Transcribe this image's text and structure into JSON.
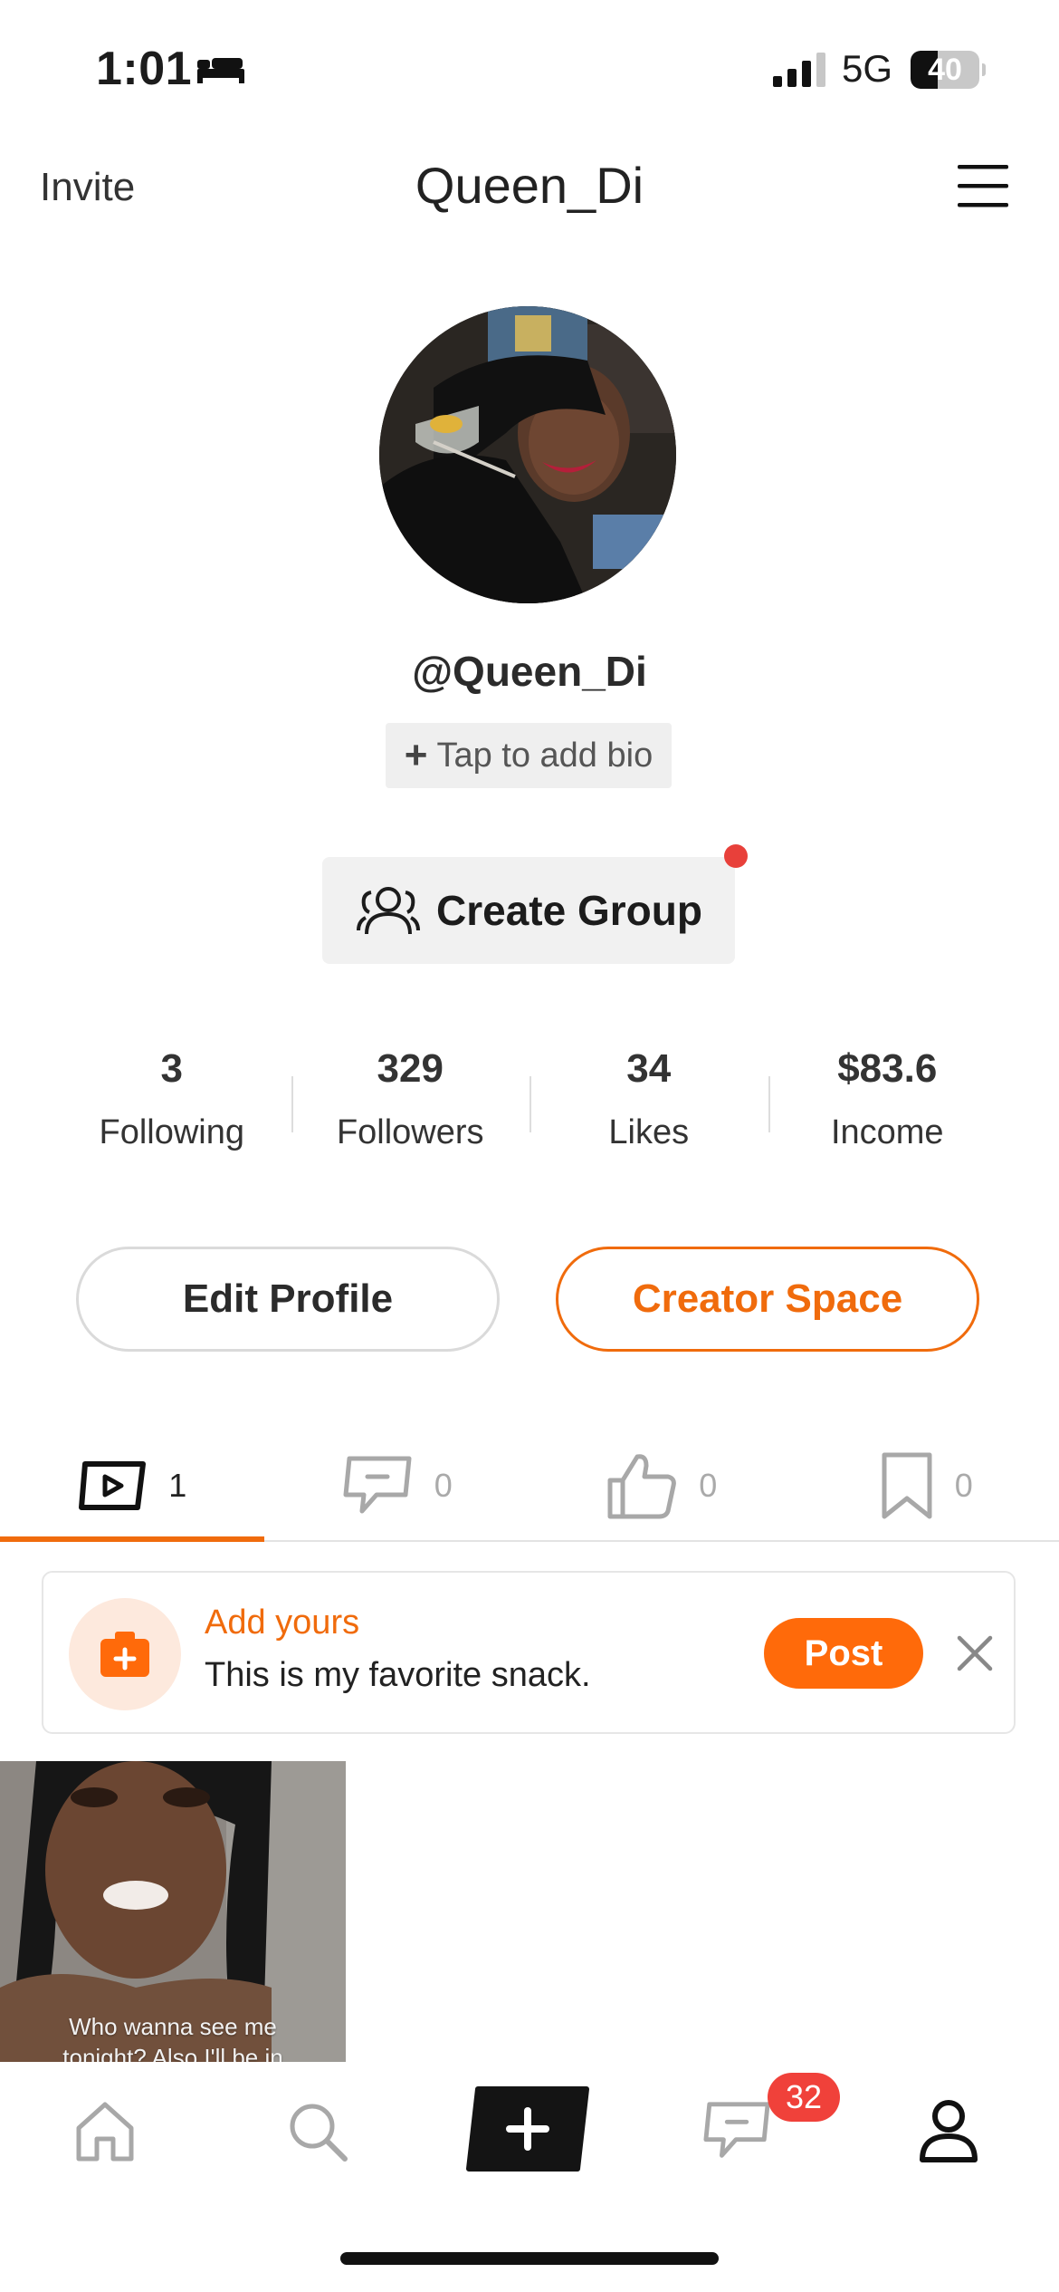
{
  "status_bar": {
    "time": "1:01",
    "network": "5G",
    "battery": "40",
    "battery_level": 0.4
  },
  "header": {
    "invite_label": "Invite",
    "title": "Queen_Di"
  },
  "profile": {
    "username": "@Queen_Di",
    "bio_placeholder": "Tap to add bio",
    "create_group_label": "Create Group"
  },
  "stats": [
    {
      "value": "3",
      "label": "Following"
    },
    {
      "value": "329",
      "label": "Followers"
    },
    {
      "value": "34",
      "label": "Likes"
    },
    {
      "value": "$83.6",
      "label": "Income"
    }
  ],
  "actions": {
    "edit_profile": "Edit Profile",
    "creator_space": "Creator Space"
  },
  "tabs": [
    {
      "icon": "video-icon",
      "count": "1",
      "active": true
    },
    {
      "icon": "comment-icon",
      "count": "0",
      "active": false
    },
    {
      "icon": "thumbs-up-icon",
      "count": "0",
      "active": false
    },
    {
      "icon": "bookmark-icon",
      "count": "0",
      "active": false
    }
  ],
  "add_yours": {
    "title": "Add yours",
    "prompt": "This is my favorite snack.",
    "post_label": "Post"
  },
  "videos": [
    {
      "caption_line1": "Who wanna see me",
      "caption_line2": "tonight? Also I'll be in"
    }
  ],
  "bottom_nav": {
    "messages_badge": "32",
    "items": [
      "home-icon",
      "search-icon",
      "plus-icon",
      "messages-icon",
      "profile-icon"
    ]
  },
  "colors": {
    "accent": "#f06b0c",
    "badge": "#f0413a",
    "text": "#1c1c1c"
  }
}
